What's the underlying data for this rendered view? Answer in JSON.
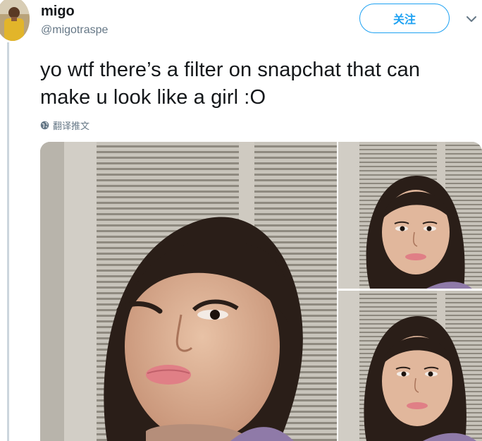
{
  "user": {
    "display_name": "migo",
    "handle": "@migotraspe"
  },
  "follow_button": {
    "label": "关注"
  },
  "tweet": {
    "text": "yo wtf there’s a filter on snapchat that can make u look like a girl :O"
  },
  "translate": {
    "label": "翻译推文"
  },
  "icons": {
    "more": "chevron-down-icon",
    "translate": "globe-icon"
  },
  "colors": {
    "accent": "#1da1f2",
    "text": "#14171a",
    "secondary": "#657786",
    "thread_line": "#ccd6dd"
  },
  "media": {
    "photo_count": 3
  }
}
